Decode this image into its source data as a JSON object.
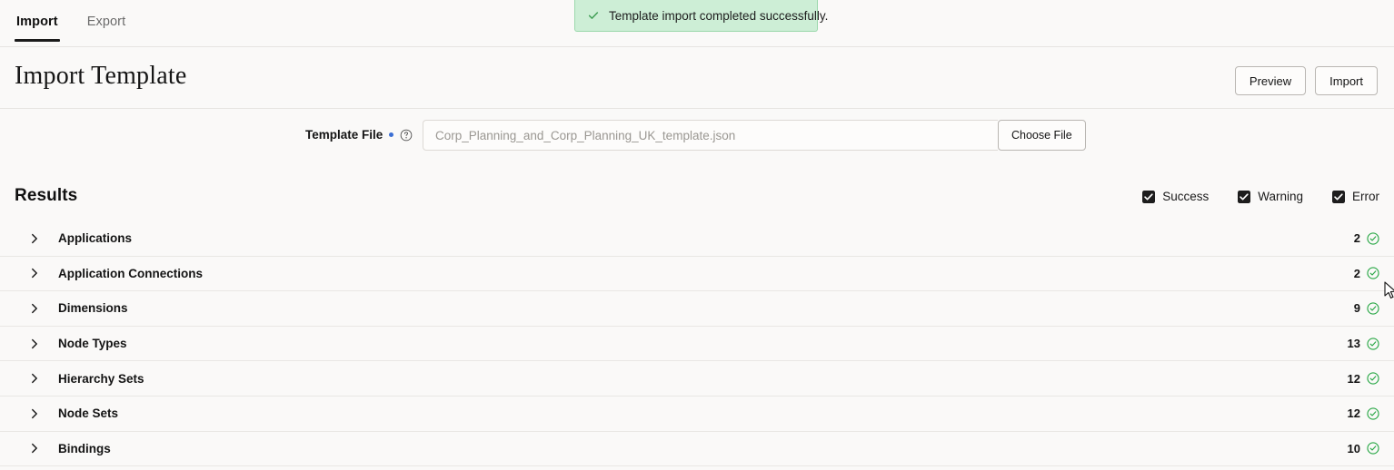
{
  "tabs": [
    {
      "label": "Import",
      "active": true
    },
    {
      "label": "Export",
      "active": false
    }
  ],
  "toast": {
    "message": "Template import completed successfully.",
    "icon": "check-icon",
    "bg_color": "#cdeed6",
    "border_color": "#9bd8ac",
    "icon_color": "#3f9e54"
  },
  "header": {
    "title": "Import Template",
    "actions": [
      {
        "label": "Preview",
        "name": "preview-button"
      },
      {
        "label": "Import",
        "name": "import-button"
      }
    ]
  },
  "file_field": {
    "label": "Template File",
    "required": true,
    "required_dot_color": "#3b6fd4",
    "help_icon": "question-circle-icon",
    "value": "",
    "placeholder": "Corp_Planning_and_Corp_Planning_UK_template.json",
    "choose_button": "Choose File"
  },
  "results": {
    "title": "Results",
    "filters": [
      {
        "label": "Success",
        "checked": true,
        "name": "filter-success"
      },
      {
        "label": "Warning",
        "checked": true,
        "name": "filter-warning"
      },
      {
        "label": "Error",
        "checked": true,
        "name": "filter-error"
      }
    ],
    "status_color": "#28a745",
    "rows": [
      {
        "label": "Applications",
        "count": "2",
        "status": "success"
      },
      {
        "label": "Application Connections",
        "count": "2",
        "status": "success"
      },
      {
        "label": "Dimensions",
        "count": "9",
        "status": "success"
      },
      {
        "label": "Node Types",
        "count": "13",
        "status": "success"
      },
      {
        "label": "Hierarchy Sets",
        "count": "12",
        "status": "success"
      },
      {
        "label": "Node Sets",
        "count": "12",
        "status": "success"
      },
      {
        "label": "Bindings",
        "count": "10",
        "status": "success"
      }
    ]
  }
}
